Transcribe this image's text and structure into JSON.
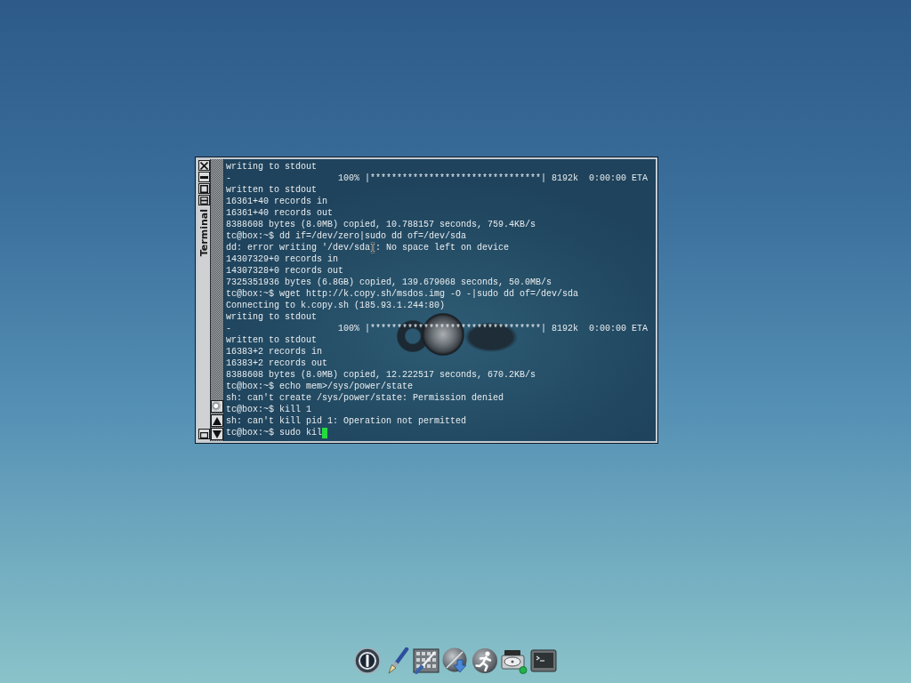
{
  "window": {
    "title": "Terminal"
  },
  "terminal": {
    "lines": [
      {
        "text": "writing to stdout"
      },
      {
        "text": "-                    100% |********************************| 8192k  0:00:00 ETA"
      },
      {
        "text": "written to stdout"
      },
      {
        "text": "16361+40 records in"
      },
      {
        "text": "16361+40 records out"
      },
      {
        "text": "8388608 bytes (8.0MB) copied, 10.788157 seconds, 759.4KB/s"
      },
      {
        "text": "tc@box:~$ dd if=/dev/zero|sudo dd of=/dev/sda"
      },
      {
        "text": "dd: error writing '/dev/sda",
        "pointer": true,
        "text_after": ": No space left on device"
      },
      {
        "text": "14307329+0 records in"
      },
      {
        "text": "14307328+0 records out"
      },
      {
        "text": "7325351936 bytes (6.8GB) copied, 139.679068 seconds, 50.0MB/s"
      },
      {
        "text": "tc@box:~$ wget http://k.copy.sh/msdos.img -O -|sudo dd of=/dev/sda"
      },
      {
        "text": "Connecting to k.copy.sh (185.93.1.244:80)"
      },
      {
        "text": "writing to stdout"
      },
      {
        "text": "-                    100% |********************************| 8192k  0:00:00 ETA"
      },
      {
        "text": "written to stdout"
      },
      {
        "text": "16383+2 records in"
      },
      {
        "text": "16383+2 records out"
      },
      {
        "text": "8388608 bytes (8.0MB) copied, 12.222517 seconds, 670.2KB/s"
      },
      {
        "text": "tc@box:~$ echo mem>/sys/power/state"
      },
      {
        "text": "sh: can't create /sys/power/state: Permission denied"
      },
      {
        "text": "tc@box:~$ kill 1"
      },
      {
        "text": "sh: can't kill pid 1: Operation not permitted"
      },
      {
        "text": "tc@box:~$ sudo kil"
      }
    ],
    "cursor_visible": true
  }
}
